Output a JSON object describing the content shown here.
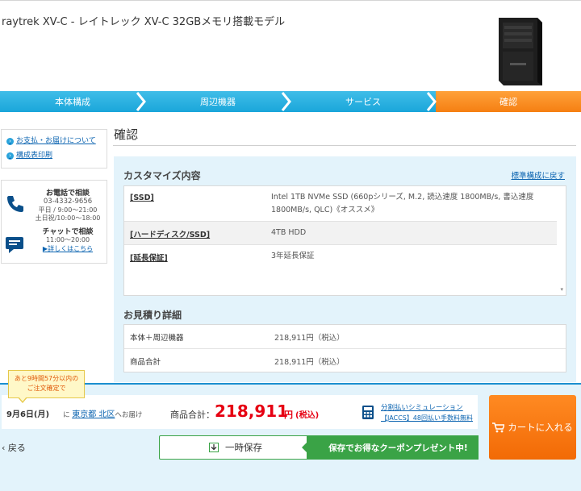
{
  "product": {
    "title": "raytrek XV-C - レイトレック XV-C 32GBメモリ搭載モデル"
  },
  "steps": [
    {
      "label": "本体構成",
      "active": false
    },
    {
      "label": "周辺機器",
      "active": false
    },
    {
      "label": "サービス",
      "active": false
    },
    {
      "label": "確認",
      "active": true
    }
  ],
  "sidebar": {
    "links": [
      "お支払・お届けについて",
      "構成表印刷"
    ],
    "phone": {
      "title": "お電話で相談",
      "number": "03-4332-9656",
      "hours1": "平日 / 9:00～21:00",
      "hours2": "土日祝/10:00～18:00"
    },
    "chat": {
      "title": "チャットで相談",
      "hours": "11:00～20:00",
      "link": "▶詳しくはこちら"
    }
  },
  "main": {
    "heading": "確認",
    "custom": {
      "title": "カスタマイズ内容",
      "back_link": "標準構成に戻す",
      "rows": [
        {
          "key": "[SSD]",
          "value": "Intel 1TB NVMe SSD (660pシリーズ, M.2, 読込速度 1800MB/s, 書込速度 1800MB/s, QLC)《オススメ》"
        },
        {
          "key": "[ハードディスク/SSD]",
          "value": "4TB HDD"
        },
        {
          "key": "[延長保証]",
          "value": "3年延長保証"
        }
      ]
    },
    "quote": {
      "title": "お見積り詳細",
      "rows": [
        {
          "key": "本体＋周辺機器",
          "value": "218,911円（税込）"
        },
        {
          "key": "商品合計",
          "value": "218,911円（税込）"
        }
      ]
    }
  },
  "footer": {
    "tooltip_line1": "あと9時間57分以内の",
    "tooltip_line2": "ご注文確定で",
    "delivery_date": "9月6日(月)",
    "delivery_ni": "に",
    "delivery_area": "東京都 北区",
    "delivery_suffix": "へお届け",
    "total_label": "商品合計：",
    "total_price": "218,911",
    "total_unit": "円",
    "total_tax": "(税込)",
    "split_link1": "分割払いシミュレーション",
    "split_link2": "【JACCS】48回払い手数料無料",
    "cart_label": "カートに入れる",
    "back_label": "戻る",
    "save_label": "一時保存",
    "coupon_label": "保存でお得なクーポンプレゼント中!"
  },
  "colors": {
    "accent_blue": "#1aa6da",
    "accent_orange": "#f57f12",
    "price_red": "#e60012",
    "green": "#3aa346"
  }
}
